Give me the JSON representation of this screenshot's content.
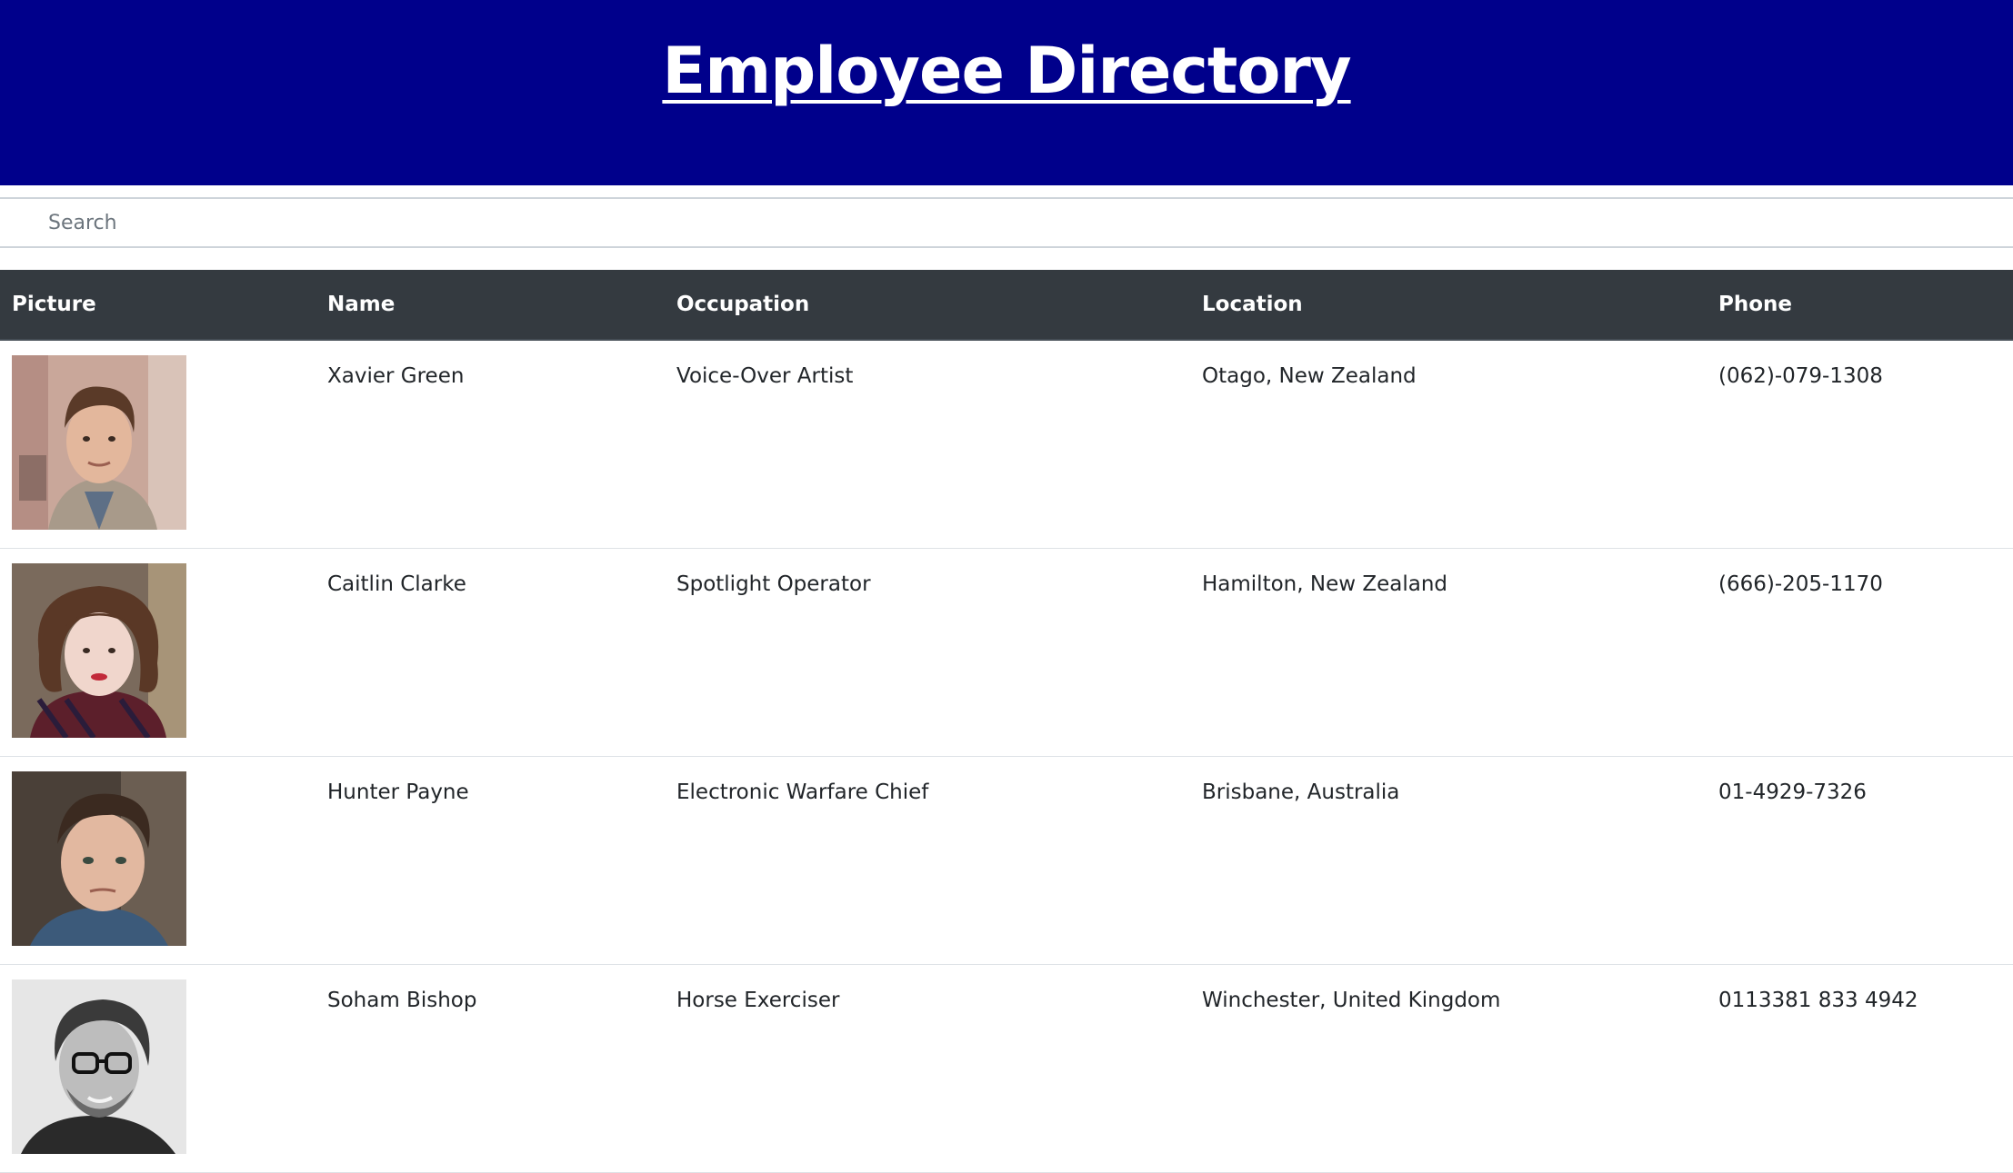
{
  "header": {
    "title": "Employee Directory"
  },
  "search": {
    "placeholder": "Search",
    "value": ""
  },
  "table": {
    "columns": [
      "Picture",
      "Name",
      "Occupation",
      "Location",
      "Phone"
    ],
    "rows": [
      {
        "name": "Xavier Green",
        "occupation": "Voice-Over Artist",
        "location": "Otago, New Zealand",
        "phone": "(062)-079-1308"
      },
      {
        "name": "Caitlin Clarke",
        "occupation": "Spotlight Operator",
        "location": "Hamilton, New Zealand",
        "phone": "(666)-205-1170"
      },
      {
        "name": "Hunter Payne",
        "occupation": "Electronic Warfare Chief",
        "location": "Brisbane, Australia",
        "phone": "01-4929-7326"
      },
      {
        "name": "Soham Bishop",
        "occupation": "Horse Exerciser",
        "location": "Winchester, United Kingdom",
        "phone": "0113381 833 4942"
      }
    ]
  },
  "colors": {
    "header_bg": "#00008b",
    "table_header_bg": "#343a40",
    "row_border": "#dee2e6"
  }
}
